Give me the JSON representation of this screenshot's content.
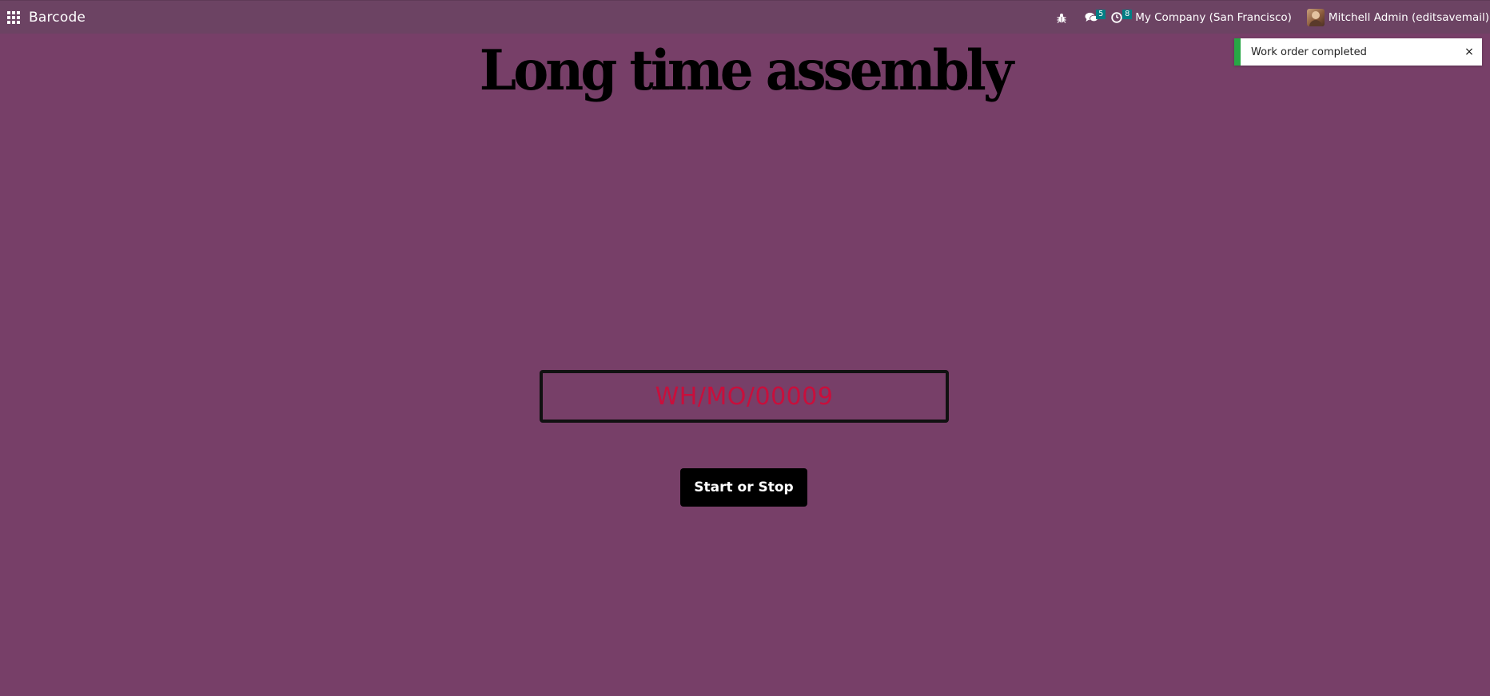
{
  "navbar": {
    "app_name": "Barcode",
    "messages_count": "5",
    "activities_count": "8",
    "company": "My Company (San Francisco)",
    "user": "Mitchell Admin (editsavemail)"
  },
  "main": {
    "title": "Long time assembly",
    "barcode_value": "WH/MO/00009",
    "action_button": "Start or Stop"
  },
  "notification": {
    "message": "Work order completed",
    "close_symbol": "×",
    "accent_color": "#28A745"
  },
  "colors": {
    "background": "#773F68",
    "navbar": "#6C4363",
    "barcode_text": "#C80F3C",
    "badge": "#017E84"
  }
}
